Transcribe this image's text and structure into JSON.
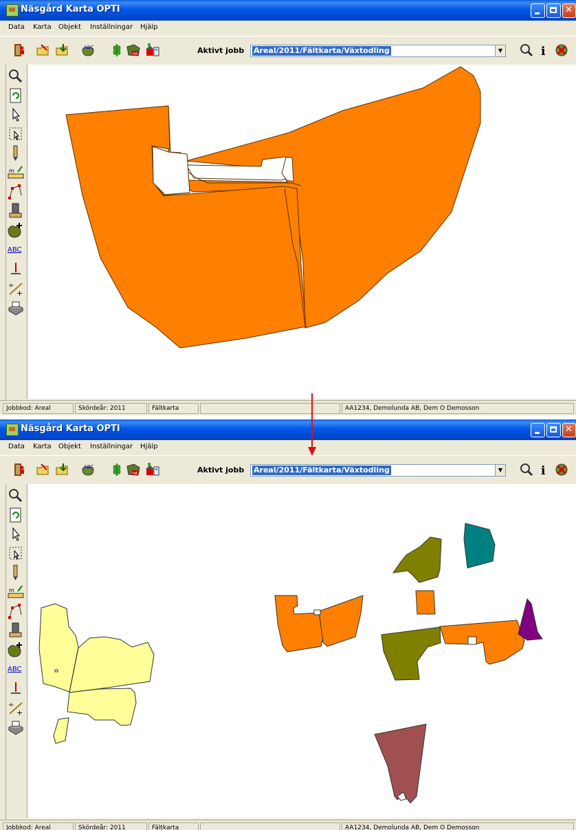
{
  "window": {
    "title": "Näsgård Karta OPTI",
    "menu": [
      "Data",
      "Karta",
      "Objekt",
      "Inställningar",
      "Hjälp"
    ],
    "job_label": "Aktivt jobb",
    "job_value": "Areal/2011/Fältkarta/Växtodling",
    "status": {
      "jobbkod": "Jobbkod: Areal",
      "skordear": "Skördeår: 2011",
      "kartnamn": "Fältkarta",
      "kund": "AA1234, Demolunda AB, Dem O Demosson"
    }
  },
  "toolbar_icons": [
    "exit-icon",
    "open-folder-icon",
    "open-folder-2-icon",
    "abc-label-icon",
    "crop-icon",
    "area-ha-icon",
    "farm-buildings-icon"
  ],
  "right_icons": [
    "zoom-icon",
    "info-icon",
    "close-job-icon"
  ],
  "left_tools": [
    "zoom-tool-icon",
    "refresh-tool-icon",
    "pointer-tool-icon",
    "select-tool-icon",
    "pencil-tool-icon",
    "measure-tool-icon",
    "edit-vertex-tool-icon",
    "sample-tool-icon",
    "add-field-tool-icon",
    "text-tool-icon",
    "marker-tool-icon",
    "calculate-tool-icon",
    "print-tool-icon"
  ],
  "colors": {
    "field_orange": "#ff8000",
    "field_yellow": "#ffff99",
    "field_olive": "#808000",
    "field_teal": "#008080",
    "field_purple": "#800080",
    "field_brown": "#a05050",
    "arrow_red": "#e01010",
    "title_blue": "#0054e3"
  }
}
